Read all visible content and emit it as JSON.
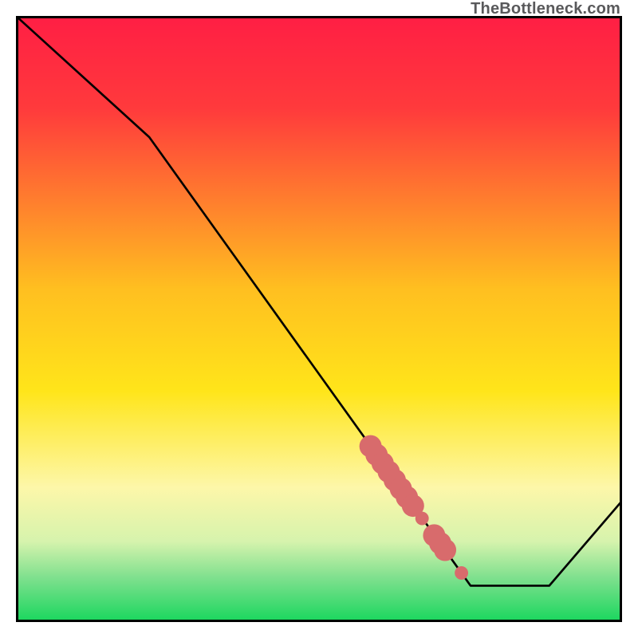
{
  "watermark": "TheBottleneck.com",
  "colors": {
    "top": "#ff1f44",
    "mid_orange": "#ffa023",
    "mid_yellow": "#ffe51a",
    "pale_yellow": "#fdf7a9",
    "green_pale": "#b6f0a2",
    "green": "#1ed760",
    "line": "#000000",
    "marker": "#d86b6c",
    "border": "#000000"
  },
  "chart_data": {
    "type": "line",
    "title": "",
    "xlabel": "",
    "ylabel": "",
    "xlim": [
      0,
      100
    ],
    "ylim": [
      0,
      100
    ],
    "series": [
      {
        "name": "curve",
        "x": [
          0,
          22,
          70,
          75,
          88,
          100
        ],
        "y": [
          100,
          80,
          13,
          6,
          6,
          20
        ]
      }
    ],
    "markers": [
      {
        "x": 58.5,
        "y": 29.0,
        "size": 5
      },
      {
        "x": 59.5,
        "y": 27.6,
        "size": 5
      },
      {
        "x": 60.5,
        "y": 26.2,
        "size": 5
      },
      {
        "x": 61.5,
        "y": 24.8,
        "size": 5
      },
      {
        "x": 62.5,
        "y": 23.4,
        "size": 5
      },
      {
        "x": 63.5,
        "y": 22.0,
        "size": 5
      },
      {
        "x": 64.5,
        "y": 20.6,
        "size": 5
      },
      {
        "x": 65.5,
        "y": 19.2,
        "size": 5
      },
      {
        "x": 67.0,
        "y": 17.1,
        "size": 3
      },
      {
        "x": 69.0,
        "y": 14.3,
        "size": 5
      },
      {
        "x": 70.0,
        "y": 13.0,
        "size": 5
      },
      {
        "x": 70.8,
        "y": 11.9,
        "size": 5
      },
      {
        "x": 73.5,
        "y": 8.1,
        "size": 3
      }
    ],
    "gradient_stops": [
      {
        "offset": 0.0,
        "color": "#ff1f44"
      },
      {
        "offset": 0.15,
        "color": "#ff3a3c"
      },
      {
        "offset": 0.45,
        "color": "#ffbf20"
      },
      {
        "offset": 0.62,
        "color": "#ffe51a"
      },
      {
        "offset": 0.78,
        "color": "#fdf7a9"
      },
      {
        "offset": 0.87,
        "color": "#d6f3ad"
      },
      {
        "offset": 0.93,
        "color": "#7fe08e"
      },
      {
        "offset": 1.0,
        "color": "#1ed760"
      }
    ]
  }
}
